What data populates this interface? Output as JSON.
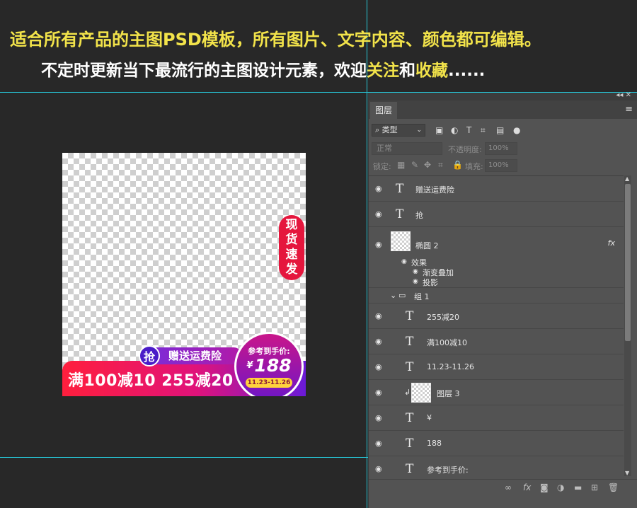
{
  "headline": {
    "line1": "适合所有产品的主图PSD模板，所有图片、文字内容、颜色都可编辑。",
    "line2_part1": "不定时更新当下最流行的主图设计元素，欢迎",
    "line2_follow": "关注",
    "line2_and": "和",
    "line2_collect": "收藏",
    "line2_dots": "......",
    "color_yellow": "#f2e34a"
  },
  "artwork": {
    "stock_tag": [
      "现",
      "货",
      "速",
      "发"
    ],
    "grab_badge": "抢",
    "shipping_text": "赠送运费险",
    "promo_text": "满100减10 255减20",
    "price_label": "参考到手价:",
    "currency": "¥",
    "price": "188",
    "date_range": "11.23-11.26",
    "colors": {
      "red": "#ff1f3d",
      "magenta": "#e0137a",
      "purple": "#6a1ad8"
    }
  },
  "panel": {
    "tab": "图层",
    "filter_kind": "类型",
    "blend_mode": "正常",
    "opacity_label": "不透明度:",
    "opacity_value": "100%",
    "lock_label": "锁定:",
    "fill_label": "填充:",
    "fill_value": "100%",
    "layers": [
      {
        "type": "text",
        "name": "赠送运费险"
      },
      {
        "type": "text",
        "name": "抢"
      },
      {
        "type": "shape",
        "name": "椭圆 2",
        "fx": "fx"
      },
      {
        "type": "effect",
        "name": "效果"
      },
      {
        "type": "effect-item",
        "name": "渐变叠加"
      },
      {
        "type": "effect-item",
        "name": "投影"
      },
      {
        "type": "group",
        "name": "组 1"
      },
      {
        "type": "text",
        "name": "255减20"
      },
      {
        "type": "text",
        "name": "满100减10"
      },
      {
        "type": "text",
        "name": "11.23-11.26"
      },
      {
        "type": "image",
        "name": "图层 3"
      },
      {
        "type": "text",
        "name": "¥"
      },
      {
        "type": "text",
        "name": "188"
      },
      {
        "type": "text",
        "name": "参考到手价:"
      }
    ]
  }
}
